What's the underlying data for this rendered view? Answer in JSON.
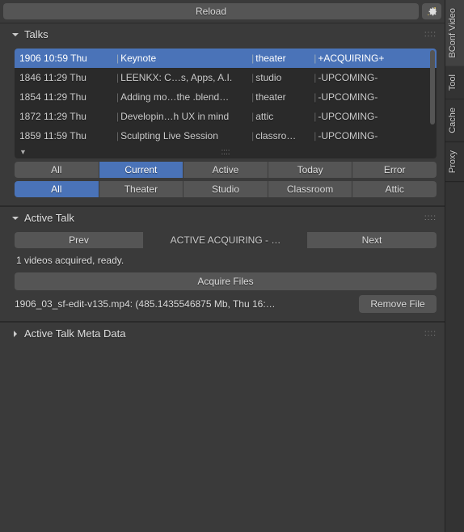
{
  "topbar": {
    "reload": "Reload"
  },
  "panels": {
    "talks": {
      "title": "Talks"
    },
    "active": {
      "title": "Active Talk"
    },
    "meta": {
      "title": "Active Talk Meta Data"
    }
  },
  "talks": {
    "rows": [
      {
        "id": "1906 10:59 Thu",
        "title": "Keynote",
        "room": "theater",
        "status": "+ACQUIRING+",
        "selected": true
      },
      {
        "id": "1846 11:29 Thu",
        "title": "LEENKX: C…s, Apps, A.I.",
        "room": "studio",
        "status": "-UPCOMING-"
      },
      {
        "id": "1854 11:29 Thu",
        "title": "Adding mo…the .blend…",
        "room": "theater",
        "status": "-UPCOMING-"
      },
      {
        "id": "1872 11:29 Thu",
        "title": "Developin…h UX in mind",
        "room": "attic",
        "status": "-UPCOMING-"
      },
      {
        "id": "1859 11:59 Thu",
        "title": "Sculpting Live Session",
        "room": "classro…",
        "status": "-UPCOMING-"
      }
    ],
    "moreIndicator": "▼"
  },
  "filters1": {
    "items": [
      "All",
      "Current",
      "Active",
      "Today",
      "Error"
    ],
    "active": 1
  },
  "filters2": {
    "items": [
      "All",
      "Theater",
      "Studio",
      "Classroom",
      "Attic"
    ],
    "active": 0
  },
  "activeTalk": {
    "prev": "Prev",
    "status": "ACTIVE ACQUIRING - …",
    "next": "Next",
    "readyLine": "1 videos acquired, ready.",
    "acquire": "Acquire Files",
    "file": "1906_03_sf-edit-v135.mp4: (485.1435546875 Mb, Thu 16:…",
    "remove": "Remove File"
  },
  "vtabs": {
    "items": [
      "BConf Video",
      "Tool",
      "Cache",
      "Proxy"
    ],
    "active": 0
  }
}
